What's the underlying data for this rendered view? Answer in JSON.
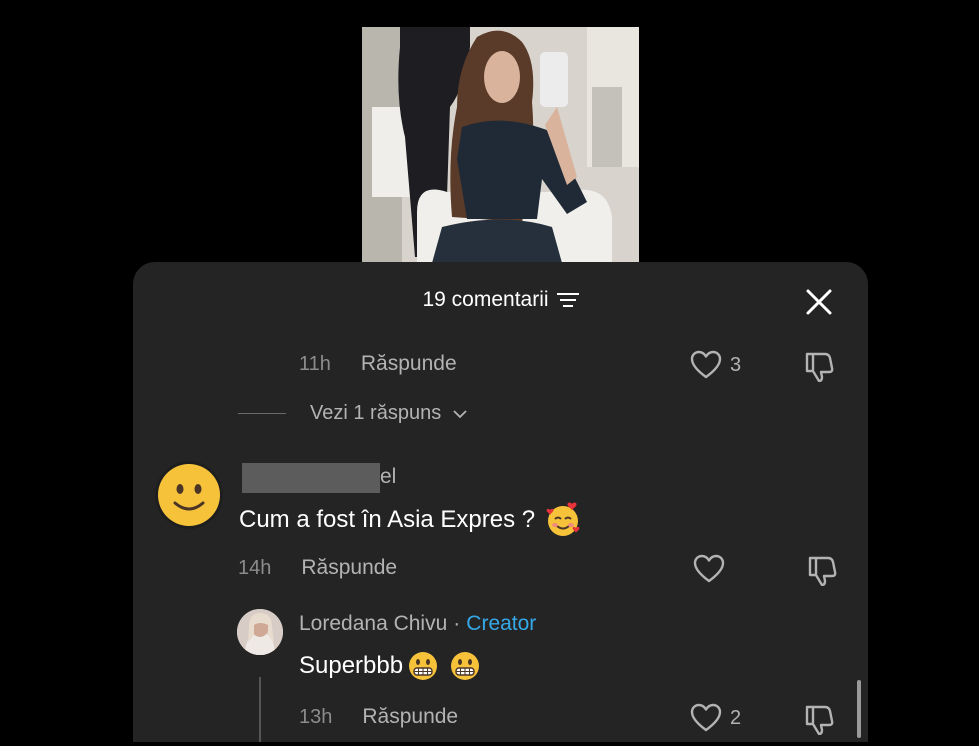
{
  "sheet": {
    "title": "19 comentarii"
  },
  "comments": [
    {
      "time": "11h",
      "reply_label": "Răspunde",
      "likes": "3"
    },
    {
      "username_suffix": "el",
      "text": "Cum a fost în Asia Expres ?",
      "emoji": "smiling-face-with-hearts",
      "time": "14h",
      "reply_label": "Răspunde",
      "likes": ""
    }
  ],
  "view_replies": {
    "label": "Vezi 1 răspuns"
  },
  "reply": {
    "author": "Loredana Chivu",
    "separator": "·",
    "badge": "Creator",
    "text": "Superbbb",
    "emojis": [
      "grimacing-face",
      "grimacing-face"
    ],
    "time": "13h",
    "reply_label": "Răspunde",
    "likes": "2"
  },
  "colors": {
    "background": "#000000",
    "sheet": "#242424",
    "creator_badge": "#35a9e8",
    "muted_text": "#b3b3b3"
  }
}
